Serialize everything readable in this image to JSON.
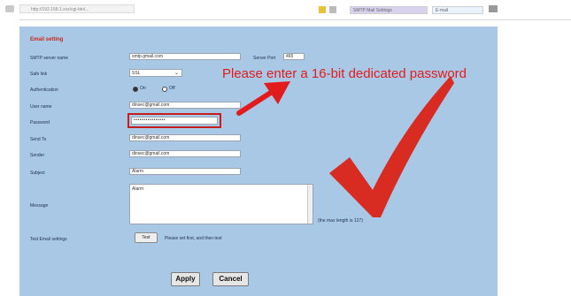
{
  "browser": {
    "address": "http://192.168.1.xxx/cgi-bin/...",
    "tab_primary": "SMTP Mail Settings",
    "tab_secondary": "E-mail"
  },
  "form": {
    "section_title": "Email setting",
    "labels": {
      "smtp_server": "SMTP server name",
      "server_port": "Server Port",
      "safe_link": "Safe link",
      "authentication": "Authentication",
      "user_name": "User name",
      "password": "Password",
      "send_to": "Send To",
      "sender": "Sender",
      "subject": "Subject",
      "message": "Message",
      "test": "Test Email settings"
    },
    "values": {
      "smtp_server": "smtp.gmail.com",
      "server_port": "465",
      "safe_link": "SSL",
      "auth_on": "On",
      "auth_off": "Off",
      "user_name": "dinsec@gmail.com",
      "password": "••••••••••••••••",
      "send_to": "dinsec@gmail.com",
      "sender": "dinsec@gmail.com",
      "subject": "Alarm",
      "message": "Alarm"
    },
    "max_length_note": "(the max length is 127)",
    "test_button": "Test",
    "test_hint": "Please set first, and then test",
    "apply_button": "Apply",
    "cancel_button": "Cancel"
  },
  "annotation": {
    "callout_text": "Please enter a 16-bit dedicated password",
    "colors": {
      "callout": "#e21c1c",
      "panel": "#a8c8e6"
    }
  }
}
